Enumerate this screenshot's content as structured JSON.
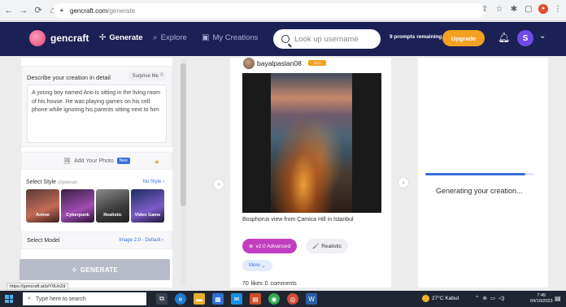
{
  "browser": {
    "url_domain": "gencraft.com",
    "url_path": "/generate",
    "status_url": "https://gencraft.ai/p/Y9UnZd"
  },
  "header": {
    "brand": "gencraft",
    "nav_generate": "Generate",
    "nav_explore": "Explore",
    "nav_creations": "My Creations",
    "search_placeholder": "Look up username",
    "prompts_remaining": "9 prompts remaining",
    "upgrade_label": "Upgrade",
    "avatar_letter": "S"
  },
  "left": {
    "describe_title": "Describe your creation in detail",
    "surprise_label": "Surprise Me",
    "prompt_text": "A young boy named Ario is sitting in the living room of his house. He was playing games on his cell phone while ignoring his parents sitting next to him",
    "add_photo_label": "Add Your Photo",
    "new_badge": "New",
    "style_title": "Select Style",
    "style_optional": "(Optional)",
    "no_style_label": "No Style",
    "styles": [
      {
        "label": "Anime"
      },
      {
        "label": "Cyberpunk"
      },
      {
        "label": "Realistic"
      },
      {
        "label": "Video Game"
      }
    ],
    "model_title": "Select Model",
    "model_value": "Image 2.0 - Default",
    "generate_label": "GENERATE"
  },
  "center": {
    "username": "bayalpaslan08",
    "pro_badge": "PRO",
    "caption": "Bosphorus view from Çamica Hill in Istanbul",
    "chip_advanced": "v2.0 Advanced",
    "chip_realistic": "Realistic",
    "chip_more": "More",
    "likes": "70 likes",
    "comments": "0 comments"
  },
  "right": {
    "generating_text": "Generating your creation...",
    "progress_fraction": 0.92
  },
  "taskbar": {
    "search_placeholder": "Type here to search",
    "weather": "27°C Kabut",
    "time": "7:45",
    "date": "04/10/2023"
  },
  "colors": {
    "header_bg": "#1b2155",
    "accent": "#3b6fd9",
    "upgrade": "#f4a021",
    "advanced_chip": "#c13ec1"
  }
}
